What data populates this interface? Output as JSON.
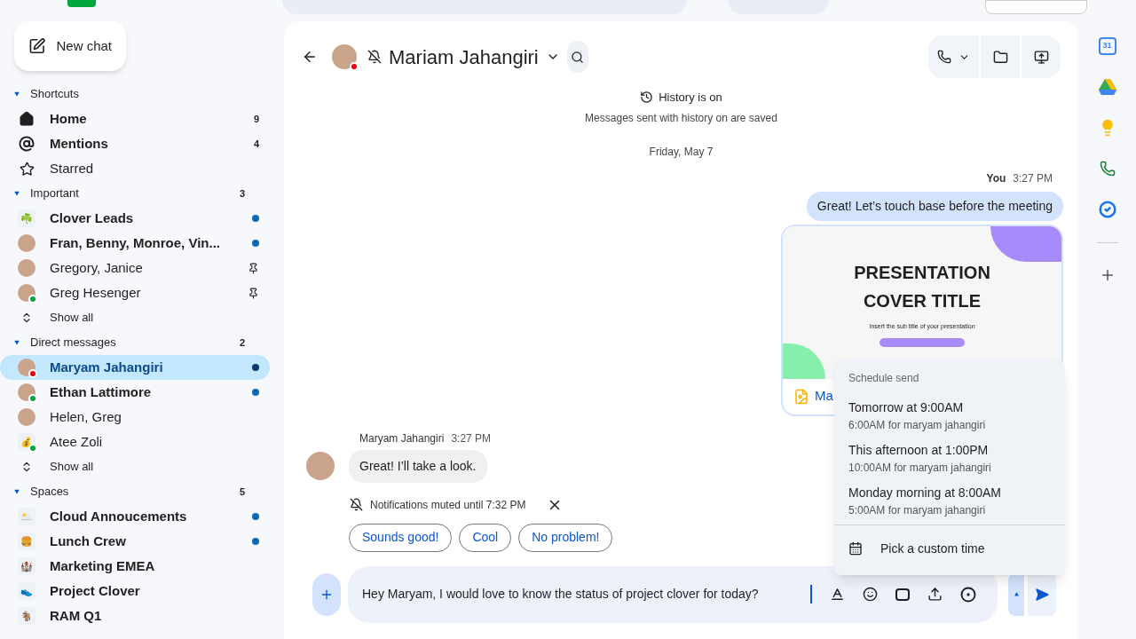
{
  "new_chat": "New chat",
  "sections": [
    {
      "label": "Shortcuts",
      "expanded": true,
      "items": [
        {
          "kind": "home",
          "name": "Home",
          "unread": true,
          "count": "9",
          "dot": false,
          "pinned": false,
          "selected": false
        },
        {
          "kind": "mentions",
          "name": "Mentions",
          "unread": true,
          "count": "4",
          "dot": false,
          "pinned": false,
          "selected": false
        },
        {
          "kind": "starred",
          "name": "Starred",
          "unread": false,
          "dot": false,
          "pinned": false,
          "selected": false
        }
      ]
    },
    {
      "label": "Important",
      "count": "3",
      "expanded": true,
      "items": [
        {
          "kind": "space",
          "emoji": "☘️",
          "name": "Clover Leads",
          "unread": true,
          "dot": true,
          "pinned": false,
          "selected": false
        },
        {
          "kind": "avatar",
          "name": "Fran, Benny, Monroe, Vin...",
          "unread": true,
          "dot": true,
          "pinned": false,
          "selected": false
        },
        {
          "kind": "avatar",
          "name": "Gregory, Janice",
          "unread": false,
          "dot": false,
          "pinned": true,
          "selected": false
        },
        {
          "kind": "avatar",
          "name": "Greg Hesenger",
          "unread": false,
          "dot": false,
          "pinned": true,
          "selected": false,
          "online": true,
          "busy": false
        },
        {
          "kind": "more",
          "name": "Show all",
          "unread": false,
          "dot": false,
          "pinned": false,
          "selected": false
        }
      ]
    },
    {
      "label": "Direct messages",
      "count": "2",
      "expanded": true,
      "items": [
        {
          "kind": "avatar",
          "name": "Maryam Jahangiri",
          "unread": true,
          "dot": true,
          "pinned": false,
          "selected": true,
          "busy": true
        },
        {
          "kind": "avatar",
          "name": "Ethan Lattimore",
          "unread": true,
          "dot": true,
          "pinned": false,
          "selected": false,
          "online": true,
          "busy": false
        },
        {
          "kind": "avatar",
          "name": "Helen, Greg",
          "unread": false,
          "dot": false,
          "pinned": false,
          "selected": false
        },
        {
          "kind": "space",
          "emoji": "💰",
          "name": "Atee Zoli",
          "unread": false,
          "dot": false,
          "pinned": false,
          "selected": false,
          "online": true,
          "busy": false
        },
        {
          "kind": "more",
          "name": "Show all",
          "unread": false,
          "dot": false,
          "pinned": false,
          "selected": false
        }
      ]
    },
    {
      "label": "Spaces",
      "count": "5",
      "expanded": true,
      "items": [
        {
          "kind": "space",
          "emoji": "🌥️",
          "name": "Cloud Annoucements",
          "unread": true,
          "dot": true,
          "pinned": false,
          "selected": false
        },
        {
          "kind": "space",
          "emoji": "🍔",
          "name": "Lunch Crew",
          "unread": true,
          "dot": true,
          "pinned": false,
          "selected": false
        },
        {
          "kind": "space",
          "emoji": "🏰",
          "name": "Marketing EMEA",
          "unread": true,
          "dot": false,
          "pinned": false,
          "selected": false
        },
        {
          "kind": "space",
          "emoji": "👟",
          "name": "Project Clover",
          "unread": true,
          "dot": false,
          "pinned": false,
          "selected": false
        },
        {
          "kind": "space",
          "emoji": "🐐",
          "name": "RAM Q1",
          "unread": true,
          "dot": false,
          "pinned": false,
          "selected": false
        }
      ]
    }
  ],
  "header": {
    "title": "Mariam Jahangiri",
    "muted": true,
    "busy": true
  },
  "history": {
    "title": "History is on",
    "subtitle": "Messages sent with history on are saved"
  },
  "date": "Friday, May 7",
  "outgoing": {
    "sender": "You",
    "time": "3:27 PM",
    "text": "Great! Let’s touch base before the meeting",
    "attachment": {
      "slide_title": "PRESENTATION COVER TITLE",
      "slide_subtitle": "Insert the sub title of your presentation",
      "file_name": "Ma"
    }
  },
  "incoming": {
    "sender": "Maryam Jahangiri",
    "time": "3:27 PM",
    "text": "Great! I’ll take a look."
  },
  "muted_notice": "Notifications muted until 7:32 PM",
  "suggestions": [
    "Sounds good!",
    "Cool",
    "No problem!"
  ],
  "composer": {
    "value": "Hey Maryam, I would love to know the status of project clover for today?"
  },
  "schedule_menu": {
    "title": "Schedule send",
    "options": [
      {
        "label": "Tomorrow at 9:00AM",
        "detail": "6:00AM for maryam jahangiri"
      },
      {
        "label": "This afternoon at 1:00PM",
        "detail": "10:00AM for maryam jahangiri"
      },
      {
        "label": "Monday morning at 8:00AM",
        "detail": "5:00AM for maryam jahangiri"
      }
    ],
    "custom": "Pick a custom time"
  },
  "rail": {
    "calendar_day": "31"
  }
}
